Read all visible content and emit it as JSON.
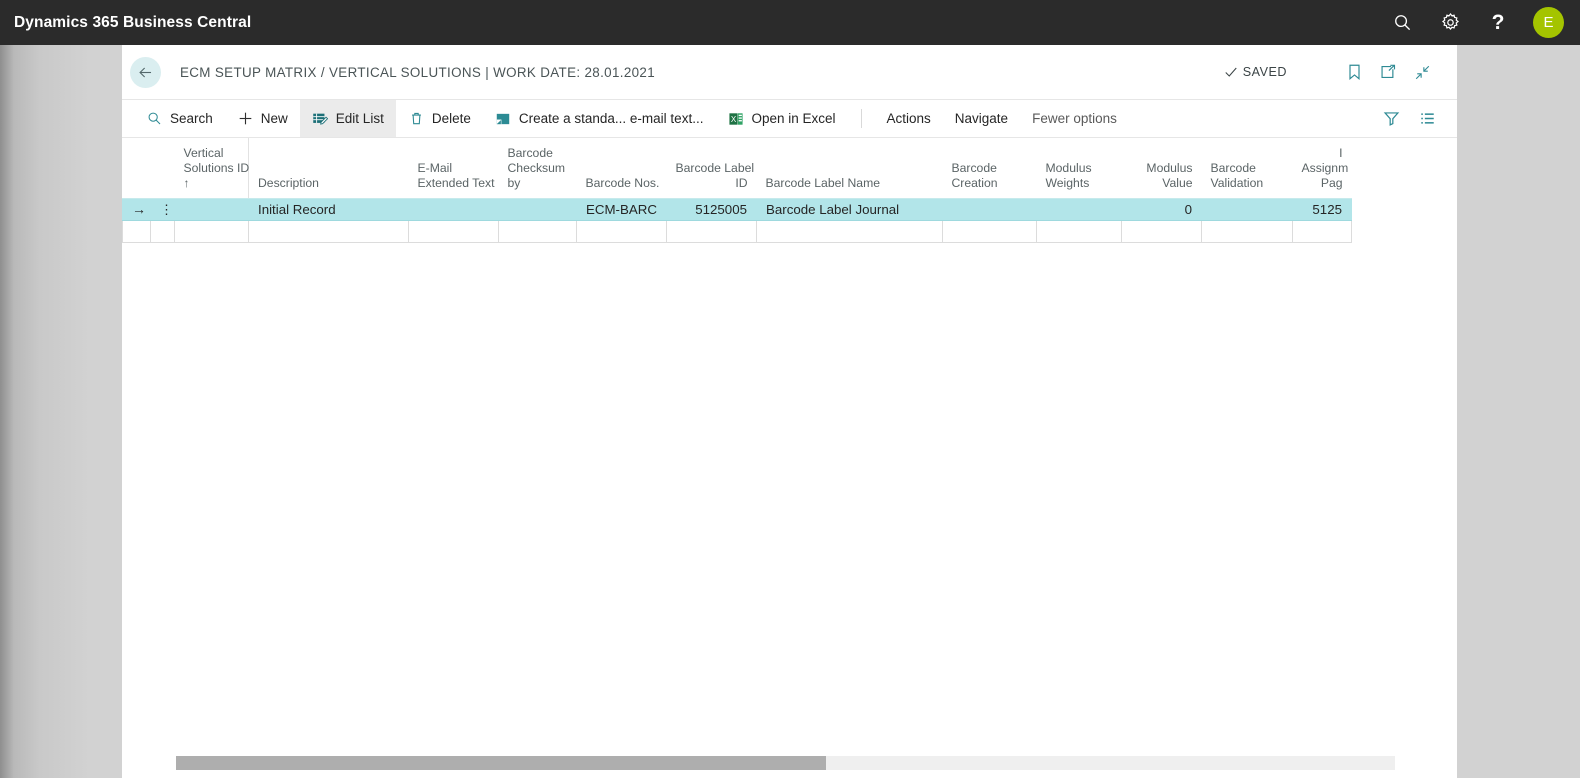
{
  "appbar": {
    "title": "Dynamics 365 Business Central",
    "search_icon": "search-icon",
    "settings_icon": "gear-icon",
    "help_label": "?",
    "avatar_initial": "E",
    "avatar_color": "#a4c400"
  },
  "header": {
    "back_icon": "back-arrow-icon",
    "title": "ECM SETUP MATRIX / VERTICAL SOLUTIONS | WORK DATE: 28.01.2021",
    "saved_label": "SAVED",
    "bookmark_icon": "bookmark-icon",
    "open-new-window_icon": "open-in-new-window-icon",
    "collapse_icon": "collapse-icon"
  },
  "toolbar": {
    "search_label": "Search",
    "new_label": "New",
    "edit_list_label": "Edit List",
    "delete_label": "Delete",
    "create_email_label": "Create a standa... e-mail text...",
    "open_excel_label": "Open in Excel",
    "actions_label": "Actions",
    "navigate_label": "Navigate",
    "fewer_options_label": "Fewer options",
    "filter_icon": "filter-icon",
    "list_view_icon": "list-view-icon"
  },
  "grid": {
    "sort_indicator": "↑",
    "row_arrow": "→",
    "row_dots": "⋮",
    "columns": [
      {
        "lines": [
          "Vertical",
          "Solutions ID"
        ],
        "align": "left",
        "sorted": true
      },
      {
        "lines": [
          "Description"
        ],
        "align": "left"
      },
      {
        "lines": [
          "E-Mail",
          "Extended Text"
        ],
        "align": "left"
      },
      {
        "lines": [
          "Barcode",
          "Checksum",
          "by"
        ],
        "align": "left"
      },
      {
        "lines": [
          "Barcode Nos."
        ],
        "align": "left"
      },
      {
        "lines": [
          "Barcode Label",
          "ID"
        ],
        "align": "right"
      },
      {
        "lines": [
          "Barcode Label Name"
        ],
        "align": "left"
      },
      {
        "lines": [
          "Barcode",
          "Creation"
        ],
        "align": "left"
      },
      {
        "lines": [
          "Modulus",
          "Weights"
        ],
        "align": "left"
      },
      {
        "lines": [
          "Modulus",
          "Value"
        ],
        "align": "right"
      },
      {
        "lines": [
          "Barcode",
          "Validation"
        ],
        "align": "left"
      },
      {
        "lines": [
          "I",
          "Assignm",
          "Pag"
        ],
        "align": "right"
      }
    ],
    "rows": [
      {
        "selected": true,
        "cells": [
          "",
          "Initial Record",
          "",
          "",
          "ECM-BARC",
          "5125005",
          "Barcode Label Journal",
          "",
          "",
          "0",
          "",
          "5125"
        ]
      },
      {
        "selected": false,
        "cells": [
          "",
          "",
          "",
          "",
          "",
          "",
          "",
          "",
          "",
          "",
          "",
          ""
        ]
      }
    ]
  },
  "scrollbar": {
    "thumb_percent": "53.3%"
  }
}
